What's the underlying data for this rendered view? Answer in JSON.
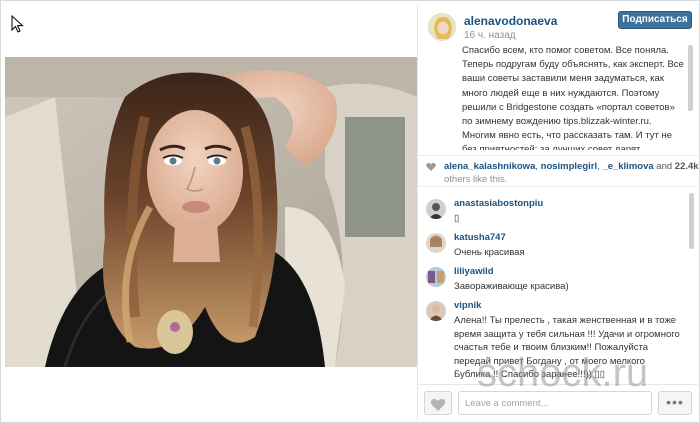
{
  "post": {
    "username": "alenavodonaeva",
    "time_ago": "16 ч. назад",
    "follow_label": "Подписаться",
    "caption": "Спасибо всем, кто помог советом. Все поняла. Теперь подругам буду объяснять, как эксперт. Все ваши советы заставили меня задуматься, как много людей еще в них нуждаются. Поэтому решили с Bridgestone создать «портал советов» по зимнему вождению tips.blizzak-winter.ru. Многим явно есть, что рассказать там. И тут не без приятностей: за лучших совет дарят"
  },
  "likes": {
    "likers": [
      "alena_kalashnikowa",
      "nosimplegirl",
      "_e_klimova"
    ],
    "separator": ",",
    "and_word": "and",
    "count": "22.4k",
    "others_text": "others like this."
  },
  "comments": [
    {
      "user": "anastasiabostonpiu",
      "text": "▯"
    },
    {
      "user": "katusha747",
      "text": "Очень красивая"
    },
    {
      "user": "liliyawild",
      "text": "Завораживающе красива)"
    },
    {
      "user": "vipnik",
      "text": "Алена!! Ты прелесть , такая женственная и в тоже время защита у тебя сильная !!! Удачи и огромного счастья тебе и твоим близким!! Пожалуйста передай привет Богдану , от моего мелкого Бублика !! Спасибо заранее!!!)) ▯▯"
    }
  ],
  "footer": {
    "comment_placeholder": "Leave a comment...",
    "more_label": "•••"
  },
  "watermark": "schock.ru",
  "colors": {
    "accent": "#3f729b",
    "username": "#1c5380",
    "muted": "#8f8f8f"
  },
  "icons": {
    "cursor": "cursor-icon",
    "like": "heart-icon",
    "more": "more-icon"
  }
}
